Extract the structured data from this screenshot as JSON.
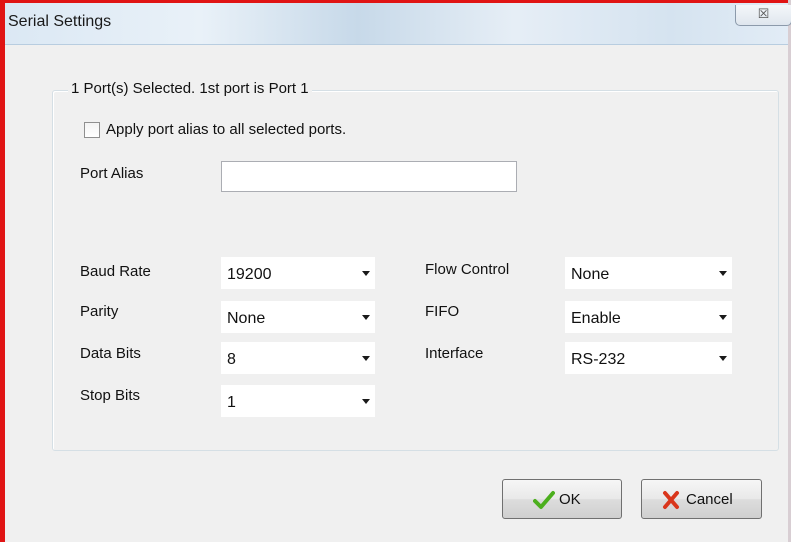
{
  "window": {
    "title": "Serial Settings",
    "close_glyph": "☒",
    "frame_color": "#e01414"
  },
  "group": {
    "caption": "1 Port(s) Selected. 1st port is Port 1"
  },
  "apply_alias": {
    "label": "Apply port alias to all selected ports.",
    "checked": false
  },
  "port_alias": {
    "label": "Port Alias",
    "value": ""
  },
  "settings": {
    "baud_rate": {
      "label": "Baud Rate",
      "value": "19200"
    },
    "parity": {
      "label": "Parity",
      "value": "None"
    },
    "data_bits": {
      "label": "Data Bits",
      "value": "8"
    },
    "stop_bits": {
      "label": "Stop Bits",
      "value": "1"
    },
    "flow_control": {
      "label": "Flow Control",
      "value": "None"
    },
    "fifo": {
      "label": "FIFO",
      "value": "Enable"
    },
    "interface": {
      "label": "Interface",
      "value": "RS-232"
    }
  },
  "buttons": {
    "ok": {
      "label": "OK",
      "icon": "checkmark-icon",
      "icon_color": "#4caf1e"
    },
    "cancel": {
      "label": "Cancel",
      "icon": "x-mark-icon",
      "icon_color": "#d9361c"
    }
  }
}
